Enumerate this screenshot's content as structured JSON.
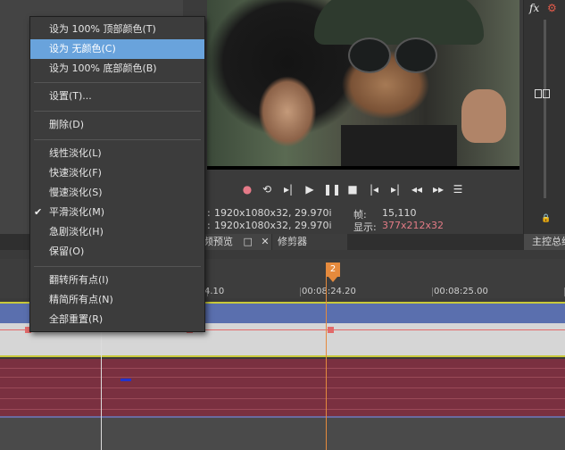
{
  "menu": {
    "items": [
      {
        "label": "设为 100% 顶部颜色(T)",
        "highlighted": false
      },
      {
        "label": "设为 无颜色(C)",
        "highlighted": true
      },
      {
        "label": "设为 100% 底部颜色(B)",
        "highlighted": false
      },
      {
        "label": "设置(T)...",
        "highlighted": false
      },
      {
        "label": "删除(D)",
        "highlighted": false
      },
      {
        "label": "线性淡化(L)",
        "highlighted": false
      },
      {
        "label": "快速淡化(F)",
        "highlighted": false
      },
      {
        "label": "慢速淡化(S)",
        "highlighted": false
      },
      {
        "label": "平滑淡化(M)",
        "highlighted": false,
        "checked": true
      },
      {
        "label": "急剧淡化(H)",
        "highlighted": false
      },
      {
        "label": "保留(O)",
        "highlighted": false
      },
      {
        "label": "翻转所有点(I)",
        "highlighted": false
      },
      {
        "label": "精简所有点(N)",
        "highlighted": false
      },
      {
        "label": "全部重置(R)",
        "highlighted": false
      }
    ],
    "check_glyph": "✔"
  },
  "transport": {
    "icons": [
      "record-icon",
      "loop-icon",
      "play-from-start-icon",
      "play-icon",
      "pause-icon",
      "stop-icon",
      "prev-frame-icon",
      "next-frame-icon",
      "rewind-icon",
      "fast-forward-icon",
      "menu-icon"
    ],
    "glyphs": [
      "●",
      "⟲",
      "▸|",
      "▶",
      "❚❚",
      "■",
      "|◂",
      "▸|",
      "◂◂",
      "▸▸",
      "☰"
    ]
  },
  "info": {
    "project_label": ":",
    "project_value": "1920x1080x32, 29.970i",
    "preview_label": ":",
    "preview_value": "1920x1080x32, 29.970i",
    "frame_label": "帧:",
    "frame_value": "15,110",
    "display_label": "显示:",
    "display_value": "377x212x32"
  },
  "tabs": {
    "preview": "频预览",
    "trimmer": "修剪器",
    "master": "主控总线"
  },
  "right_panel": {
    "fx_label": "fx",
    "gear_glyph": "⚙",
    "lock_glyph": "🔒"
  },
  "timeline": {
    "marker_number": "2",
    "time_labels": [
      "4.10",
      "00:08:24.20",
      "00:08:25.00"
    ]
  },
  "colors": {
    "menu_highlight": "#69a3dc",
    "video_track": "#5a6fae",
    "audio_track": "#7a3040",
    "playhead": "#e58a3d",
    "envelope": "#e26a6a"
  }
}
